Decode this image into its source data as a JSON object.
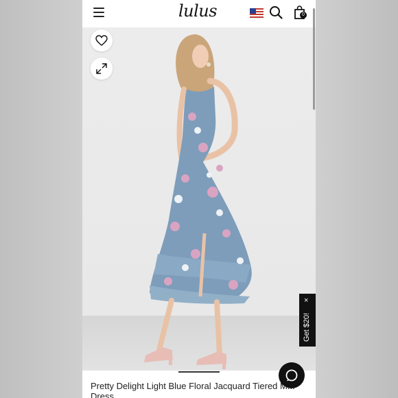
{
  "header": {
    "logo": "lulus",
    "menu_icon": "hamburger-menu-icon",
    "flag_icon": "us-flag-icon",
    "search_icon": "search-icon",
    "bag_icon": "shopping-bag-icon",
    "bag_count": "0"
  },
  "product_image": {
    "favorite_icon": "heart-icon",
    "expand_icon": "expand-icon"
  },
  "promo": {
    "label": "Get $20!",
    "close": "×"
  },
  "chat": {
    "icon": "chat-bubble-icon"
  },
  "product": {
    "title": "Pretty Delight Light Blue Floral Jacquard Tiered M... Dress"
  },
  "colors": {
    "header_bg": "#ffffff",
    "dress_blue": "#7d9dbb",
    "floral_pink": "#d9a4c2",
    "promo_bg": "#111111"
  }
}
